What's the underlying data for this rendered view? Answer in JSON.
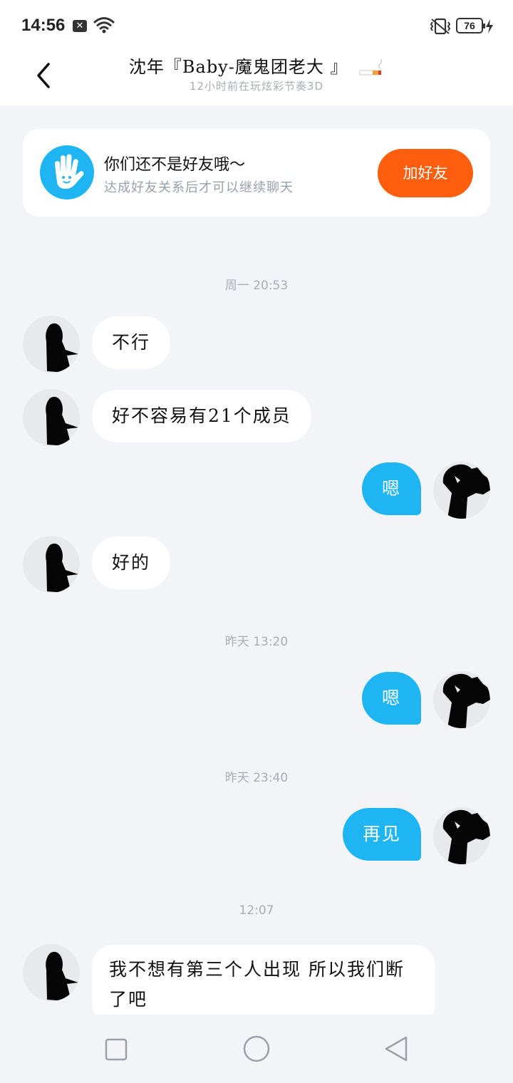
{
  "status_bar": {
    "time": "14:56",
    "battery": "76"
  },
  "header": {
    "contact_name": "沈年『Baby-魔鬼团老大 』",
    "status": "12小时前在玩炫彩节奏3D"
  },
  "friend_card": {
    "title": "你们还不是好友哦～",
    "subtitle": "达成好友关系后才可以继续聊天",
    "button": "加好友"
  },
  "messages": [
    {
      "type": "time",
      "text": "周一 20:53"
    },
    {
      "type": "in",
      "text": "不行"
    },
    {
      "type": "in",
      "text": "好不容易有21个成员"
    },
    {
      "type": "out",
      "text": "嗯"
    },
    {
      "type": "in",
      "text": "好的"
    },
    {
      "type": "time",
      "text": "昨天 13:20"
    },
    {
      "type": "out",
      "text": "嗯"
    },
    {
      "type": "time",
      "text": "昨天 23:40"
    },
    {
      "type": "out",
      "text": "再见"
    },
    {
      "type": "time",
      "text": "12:07"
    },
    {
      "type": "in",
      "text": "我不想有第三个人出现 所以我们断了吧"
    }
  ],
  "colors": {
    "accent_blue": "#1eb5f2",
    "add_friend_orange": "#ff5e0e",
    "background": "#f2f4f7"
  },
  "icons": {
    "back": "chevron-left-icon",
    "friend_avatar": "hand-icon",
    "nav_recents": "square-icon",
    "nav_home": "circle-icon",
    "nav_back": "triangle-icon"
  }
}
